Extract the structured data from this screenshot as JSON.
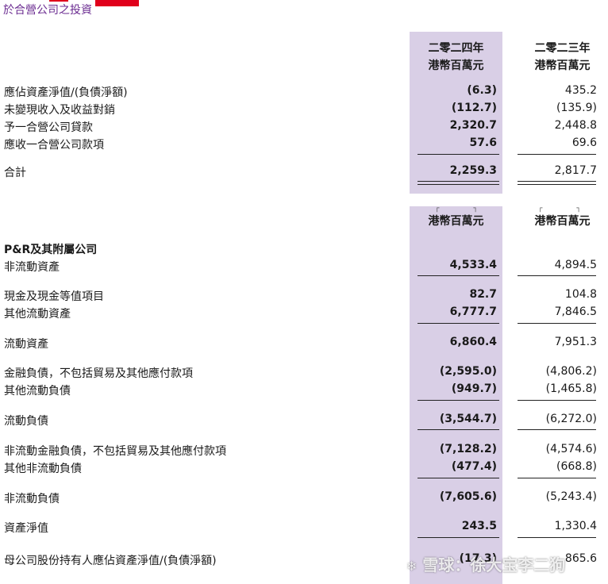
{
  "header": {
    "title": "於合營公司之投資"
  },
  "columns": {
    "year_2024": "二零二四年",
    "year_2023": "二零二三年",
    "unit": "港幣百萬元"
  },
  "table1": {
    "rows": [
      {
        "label": "應佔資產淨值/(負債淨額)",
        "v2024": "(6.3)",
        "v2023": "435.2"
      },
      {
        "label": "未變現收入及收益對銷",
        "v2024": "(112.7)",
        "v2023": "(135.9)"
      },
      {
        "label": "予一合營公司貸款",
        "v2024": "2,320.7",
        "v2023": "2,448.8"
      },
      {
        "label": "應收一合營公司款項",
        "v2024": "57.6",
        "v2023": "69.6"
      }
    ],
    "total": {
      "label": "合計",
      "v2024": "2,259.3",
      "v2023": "2,817.7"
    }
  },
  "table2": {
    "section_title": "P&R及其附屬公司",
    "rows": [
      {
        "label": "非流動資產",
        "v2024": "4,533.4",
        "v2023": "4,894.5"
      },
      {
        "label": "現金及現金等值項目",
        "v2024": "82.7",
        "v2023": "104.8"
      },
      {
        "label": "其他流動資產",
        "v2024": "6,777.7",
        "v2023": "7,846.5"
      },
      {
        "label": "流動資產",
        "v2024": "6,860.4",
        "v2023": "7,951.3"
      },
      {
        "label": "金融負債，不包括貿易及其他應付款項",
        "v2024": "(2,595.0)",
        "v2023": "(4,806.2)"
      },
      {
        "label": "其他流動負債",
        "v2024": "(949.7)",
        "v2023": "(1,465.8)"
      },
      {
        "label": "流動負債",
        "v2024": "(3,544.7)",
        "v2023": "(6,272.0)"
      },
      {
        "label": "非流動金融負債，不包括貿易及其他應付款項",
        "v2024": "(7,128.2)",
        "v2023": "(4,574.6)"
      },
      {
        "label": "其他非流動負債",
        "v2024": "(477.4)",
        "v2023": "(668.8)"
      },
      {
        "label": "非流動負債",
        "v2024": "(7,605.6)",
        "v2023": "(5,243.4)"
      },
      {
        "label": "資產淨值",
        "v2024": "243.5",
        "v2023": "1,330.4"
      },
      {
        "label": "母公司股份持有人應佔資產淨值/(負債淨額)",
        "v2024": "(17.3)",
        "v2023": "865.6"
      }
    ]
  },
  "watermark": {
    "icon": "snowball-icon",
    "text": "雪球：徐大宝李二狗"
  },
  "colors": {
    "band": "#d9cfe6",
    "header": "#6b2c91",
    "red": "#e0001b"
  }
}
